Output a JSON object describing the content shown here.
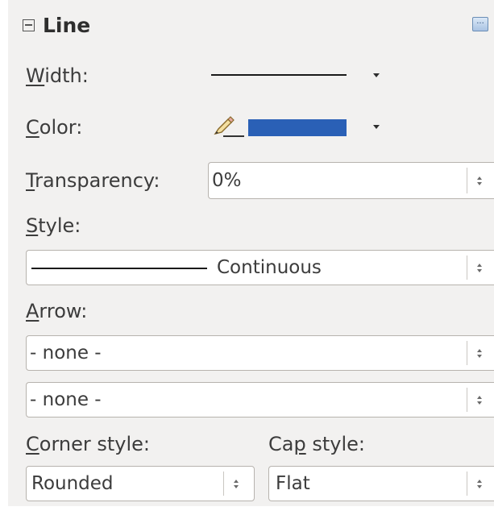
{
  "section": {
    "title": "Line",
    "more_options_icon": "more-options-icon",
    "more_label": "..."
  },
  "width": {
    "label_key": "W",
    "label_rest": "idth:"
  },
  "color": {
    "label_key": "C",
    "label_rest": "olor:",
    "value": "#2a60b6",
    "icon": "pencil-icon"
  },
  "transparency": {
    "label_key": "T",
    "label_rest": "ransparency:",
    "value": "0%"
  },
  "style": {
    "label_key": "S",
    "label_rest": "tyle:",
    "value": "Continuous"
  },
  "arrow": {
    "label_key": "A",
    "label_rest": "rrow:",
    "start": "- none -",
    "end": "- none -"
  },
  "corner_style": {
    "label_key": "C",
    "label_rest": "orner style:",
    "value": "Rounded"
  },
  "cap_style": {
    "label_pre": "Ca",
    "label_key": "p",
    "label_rest": " style:",
    "value": "Flat"
  }
}
